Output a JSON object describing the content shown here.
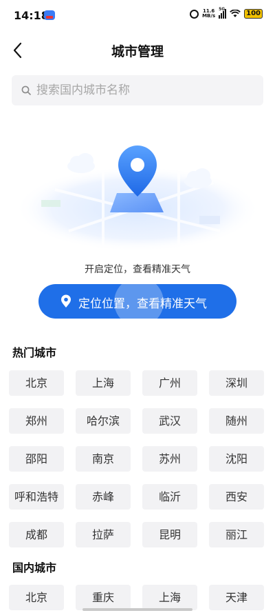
{
  "status_bar": {
    "time": "14:18",
    "net_speed_value": "11.6",
    "net_speed_unit": "MB/s",
    "network": "5G",
    "battery": "100"
  },
  "header": {
    "title": "城市管理",
    "back_icon": "chevron-left-icon"
  },
  "search": {
    "placeholder": "搜索国内城市名称",
    "value": "",
    "icon": "search-icon"
  },
  "locate": {
    "hint": "开启定位，查看精准天气",
    "button_label": "定位位置，查看精准天气",
    "button_icon": "location-pin-icon",
    "accent_color": "#1f6fe8"
  },
  "hot_cities": {
    "title": "热门城市",
    "items": [
      "北京",
      "上海",
      "广州",
      "深圳",
      "郑州",
      "哈尔滨",
      "武汉",
      "随州",
      "邵阳",
      "南京",
      "苏州",
      "沈阳",
      "呼和浩特",
      "赤峰",
      "临沂",
      "西安",
      "成都",
      "拉萨",
      "昆明",
      "丽江"
    ]
  },
  "domestic_cities": {
    "title": "国内城市",
    "items": [
      "北京",
      "重庆",
      "上海",
      "天津"
    ]
  }
}
